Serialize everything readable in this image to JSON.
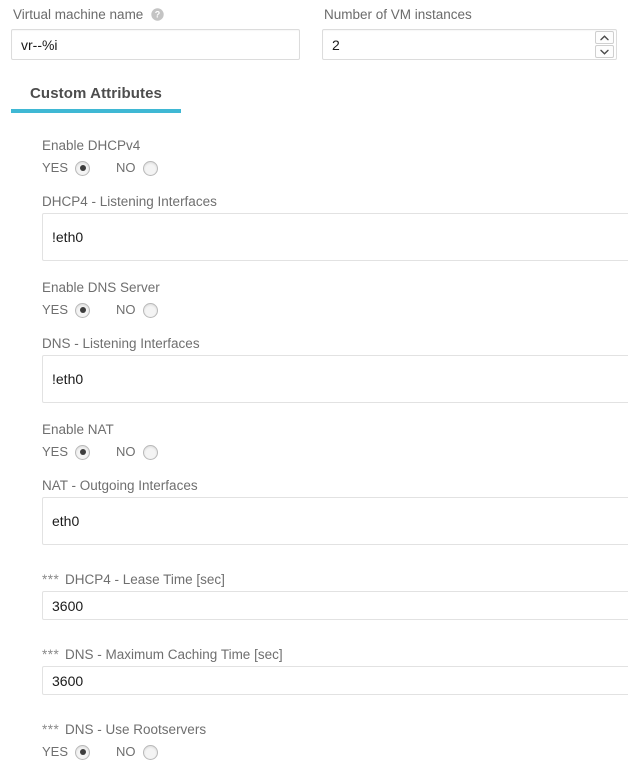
{
  "top_fields": {
    "vm_name": {
      "label": "Virtual machine name",
      "help_icon": "help-circle-icon",
      "value": "vr--%i",
      "placeholder": ""
    },
    "vm_instances": {
      "label": "Number of VM instances",
      "value": "2",
      "placeholder": "",
      "spinner_up_icon": "chevron-up-icon",
      "spinner_down_icon": "chevron-down-icon"
    }
  },
  "tabs": [
    {
      "label": "Custom Attributes",
      "active": true
    }
  ],
  "colors": {
    "accent": "#3fb8d4",
    "label_text": "#6f6f6f",
    "value_text": "#1a1a1a",
    "input_border": "#dcdcdc"
  },
  "radio_options": {
    "yes_label": "YES",
    "no_label": "NO"
  },
  "attributes": [
    {
      "type": "radio",
      "label": "Enable DHCPv4",
      "stars": "",
      "selected": "YES"
    },
    {
      "type": "text",
      "label": "DHCP4 - Listening Interfaces",
      "stars": "",
      "value": "!eth0",
      "size": "tall"
    },
    {
      "type": "radio",
      "label": "Enable DNS Server",
      "stars": "",
      "selected": "YES"
    },
    {
      "type": "text",
      "label": "DNS - Listening Interfaces",
      "stars": "",
      "value": "!eth0",
      "size": "tall"
    },
    {
      "type": "radio",
      "label": "Enable NAT",
      "stars": "",
      "selected": "YES"
    },
    {
      "type": "text",
      "label": "NAT - Outgoing Interfaces",
      "stars": "",
      "value": "eth0",
      "size": "tall"
    },
    {
      "type": "text",
      "label": "DHCP4 - Lease Time [sec]",
      "stars": "***",
      "value": "3600",
      "size": "short"
    },
    {
      "type": "text",
      "label": "DNS - Maximum Caching Time [sec]",
      "stars": "***",
      "value": "3600",
      "size": "short"
    },
    {
      "type": "radio",
      "label": "DNS - Use Rootservers",
      "stars": "***",
      "selected": "YES"
    }
  ]
}
